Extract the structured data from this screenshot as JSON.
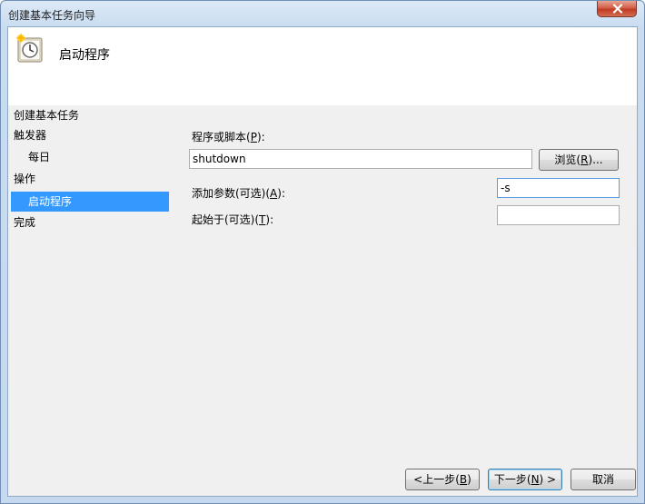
{
  "window": {
    "title": "创建基本任务向导"
  },
  "header": {
    "title": "启动程序",
    "icon": "task-clock-icon"
  },
  "nav": {
    "heading": "创建基本任务",
    "items": [
      {
        "label": "触发器",
        "level": 0,
        "selected": false
      },
      {
        "label": "每日",
        "level": 1,
        "selected": false
      },
      {
        "label": "操作",
        "level": 0,
        "selected": false
      },
      {
        "label": "启动程序",
        "level": 1,
        "selected": true
      },
      {
        "label": "完成",
        "level": 0,
        "selected": false
      }
    ]
  },
  "form": {
    "program_label_pre": "程序或脚本(",
    "program_label_key": "P",
    "program_label_post": "):",
    "program_value": "shutdown",
    "browse_pre": "浏览(",
    "browse_key": "R",
    "browse_post": ")...",
    "args_label_pre": "添加参数(可选)(",
    "args_label_key": "A",
    "args_label_post": "):",
    "args_value": "-s",
    "startin_label_pre": "起始于(可选)(",
    "startin_label_key": "T",
    "startin_label_post": "):",
    "startin_value": ""
  },
  "footer": {
    "back_pre": "<上一步(",
    "back_key": "B",
    "back_post": ")",
    "next_pre": "下一步(",
    "next_key": "N",
    "next_post": ") >",
    "cancel": "取消"
  },
  "colors": {
    "selection": "#3399ff",
    "close": "#c23a23"
  }
}
